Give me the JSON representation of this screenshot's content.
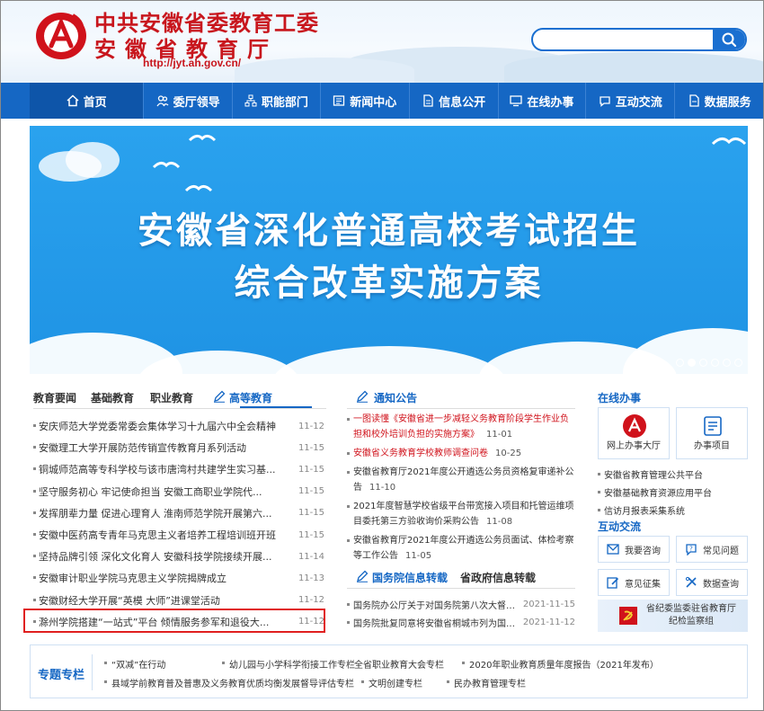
{
  "header": {
    "title_line1": "中共安徽省委教育工委",
    "title_line2": "安徽省教育厅",
    "url": "http://jyt.ah.gov.cn/",
    "search_placeholder": ""
  },
  "nav": [
    {
      "label": "首页",
      "icon": "home-icon"
    },
    {
      "label": "委厅领导",
      "icon": "people-icon"
    },
    {
      "label": "职能部门",
      "icon": "org-icon"
    },
    {
      "label": "新闻中心",
      "icon": "news-icon"
    },
    {
      "label": "信息公开",
      "icon": "doc-icon"
    },
    {
      "label": "在线办事",
      "icon": "monitor-icon"
    },
    {
      "label": "互动交流",
      "icon": "chat-icon"
    },
    {
      "label": "数据服务",
      "icon": "data-icon"
    }
  ],
  "banner": {
    "line1": "安徽省深化普通高校考试招生",
    "line2": "综合改革实施方案",
    "active_slide": 2,
    "slide_count": 6
  },
  "left_tabs": [
    "教育要闻",
    "基础教育",
    "职业教育",
    "高等教育"
  ],
  "left_list": [
    {
      "title": "安庆师范大学党委常委会集体学习十九届六中全会精神",
      "date": "11-12"
    },
    {
      "title": "安徽理工大学开展防范传销宣传教育月系列活动",
      "date": "11-15"
    },
    {
      "title": "铜城师范高等专科学校与该市唐湾村共建学生实习基...",
      "date": "11-15"
    },
    {
      "title": "坚守服务初心 牢记使命担当 安徽工商职业学院代...",
      "date": "11-15"
    },
    {
      "title": "发挥朋辈力量 促进心理育人 淮南师范学院开展第六...",
      "date": "11-15"
    },
    {
      "title": "安徽中医药高专青年马克思主义者培养工程培训班开班",
      "date": "11-15"
    },
    {
      "title": "坚持品牌引领 深化文化育人 安徽科技学院接续开展...",
      "date": "11-14"
    },
    {
      "title": "安徽审计职业学院马克思主义学院揭牌成立",
      "date": "11-13"
    },
    {
      "title": "安徽财经大学开展“英模 大师”进课堂活动",
      "date": "11-12"
    },
    {
      "title": "滁州学院搭建“一站式”平台 倾情服务参军和退役大...",
      "date": "11-12"
    }
  ],
  "notice": {
    "title": "通知公告",
    "items": [
      {
        "title": "一图读懂《安徽省进一步减轻义务教育阶段学生作业负担和校外培训负担的实施方案》",
        "date": "11-01",
        "red": true
      },
      {
        "title": "安徽省义务教育学校教师调查问卷",
        "date": "10-25",
        "red": true
      },
      {
        "title": "安徽省教育厅2021年度公开遴选公务员资格复审递补公告",
        "date": "11-10",
        "red": false
      },
      {
        "title": "2021年度智慧学校省级平台带宽接入项目和托管运维项目委托第三方验收询价采购公告",
        "date": "11-08",
        "red": false
      },
      {
        "title": "安徽省教育厅2021年度公开遴选公务员面试、体检考察等工作公告",
        "date": "11-05",
        "red": false
      }
    ]
  },
  "state_council": {
    "title": "国务院信息转载",
    "title2": "省政府信息转载",
    "items": [
      {
        "title": "国务院办公厅关于对国务院第八次大督查发...",
        "date": "2021-11-15"
      },
      {
        "title": "国务院批复同意将安徽省桐城市列为国家历...",
        "date": "2021-11-12"
      }
    ]
  },
  "online": {
    "title": "在线办事",
    "boxes": [
      {
        "label": "网上办事大厅",
        "icon": "gov-service-icon"
      },
      {
        "label": "办事项目",
        "icon": "list-icon"
      }
    ],
    "links": [
      "安徽省教育管理公共平台",
      "安徽基础教育资源应用平台",
      "信访月报表采集系统"
    ]
  },
  "interact": {
    "title": "互动交流",
    "buttons": [
      {
        "label": "我要咨询",
        "icon": "mail-icon"
      },
      {
        "label": "常见问题",
        "icon": "question-icon"
      },
      {
        "label": "意见征集",
        "icon": "edit-icon"
      },
      {
        "label": "数据查询",
        "icon": "query-icon"
      }
    ],
    "party_line1": "省纪委监委驻省教育厅",
    "party_line2": "纪检监察组"
  },
  "special": {
    "title": "专题专栏",
    "links": [
      "“双减”在行动",
      "幼儿园与小学科学衔接工作专栏",
      "全省职业教育大会专栏",
      "2020年职业教育质量年度报告（2021年发布）",
      "县域学前教育普及普惠及义务教育优质均衡发展督导评估专栏",
      "文明创建专栏",
      "民办教育管理专栏"
    ]
  },
  "colors": {
    "primary": "#1567c4",
    "brand_red": "#c8161d",
    "banner": "#2aa2ee"
  }
}
